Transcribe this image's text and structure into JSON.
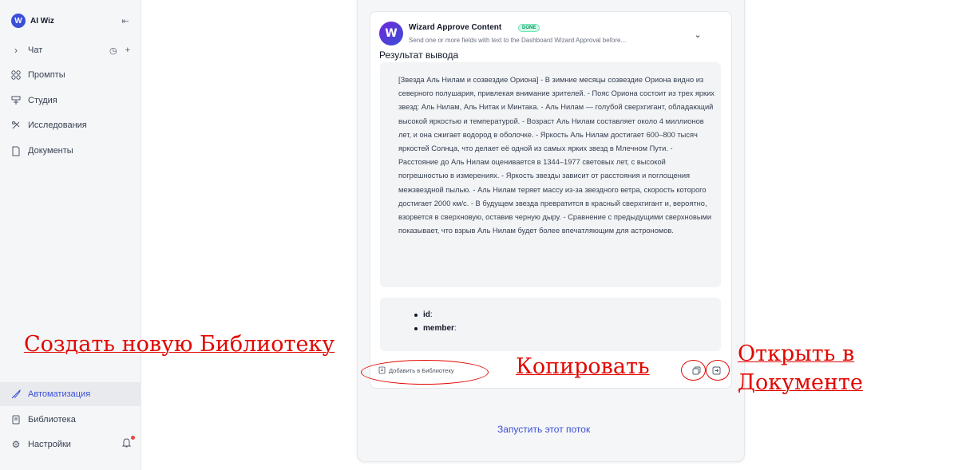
{
  "app": {
    "name": "AI Wiz",
    "logo_letter": "W"
  },
  "sidebar": {
    "chat_label": "Чат",
    "items": [
      {
        "label": "Промпты",
        "icon": "grid-icon"
      },
      {
        "label": "Студия",
        "icon": "studio-icon"
      },
      {
        "label": "Исследования",
        "icon": "research-icon"
      },
      {
        "label": "Документы",
        "icon": "document-icon"
      }
    ],
    "bottom_items": [
      {
        "label": "Автоматизация",
        "icon": "rocket-icon",
        "active": true
      },
      {
        "label": "Библиотека",
        "icon": "library-icon"
      },
      {
        "label": "Настройки",
        "icon": "settings-icon"
      }
    ]
  },
  "card": {
    "title": "Wizard Approve Content",
    "badge": "DONE",
    "subtitle": "Send one or more fields with text to the Dashboard Wizard Approval before...",
    "result_label": "Результат вывода",
    "output_text": "[Звезда Аль Нилам и созвездие Ориона] - В зимние месяцы созвездие Ориона видно из северного полушария, привлекая внимание зрителей. - Пояс Ориона состоит из трех ярких звезд: Аль Нилам, Аль Нитак и Минтака. - Аль Нилам — голубой сверхгигант, обладающий высокой яркостью и температурой. - Возраст Аль Нилам составляет около 4 миллионов лет, и она сжигает водород в оболочке. - Яркость Аль Нилам достигает 600–800 тысяч яркостей Солнца, что делает её одной из самых ярких звезд в Млечном Пути. - Расстояние до Аль Нилам оценивается в 1344–1977 световых лет, с высокой погрешностью в измерениях. - Яркость звезды зависит от расстояния и поглощения межзвездной пылью. - Аль Нилам теряет массу из-за звездного ветра, скорость которого достигает 2000 км/с. - В будущем звезда превратится в красный сверхгигант и, вероятно, взорвется в сверхновую, оставив черную дыру. - Сравнение с предыдущими сверхновыми показывает, что взрыв Аль Нилам будет более впечатляющим для астрономов.",
    "fields": [
      {
        "key": "id",
        "value": ""
      },
      {
        "key": "member",
        "value": ""
      }
    ],
    "add_to_library": "Добавить в Библиотеку",
    "run_flow": "Запустить этот поток"
  },
  "annotations": {
    "create_library": "Создать новую Библиотеку",
    "copy": "Копировать",
    "open_line1": "Открыть в",
    "open_line2": "Документе",
    "color": "#e10600"
  },
  "colors": {
    "accent": "#3b4fd8",
    "badge_green": "#059669"
  }
}
